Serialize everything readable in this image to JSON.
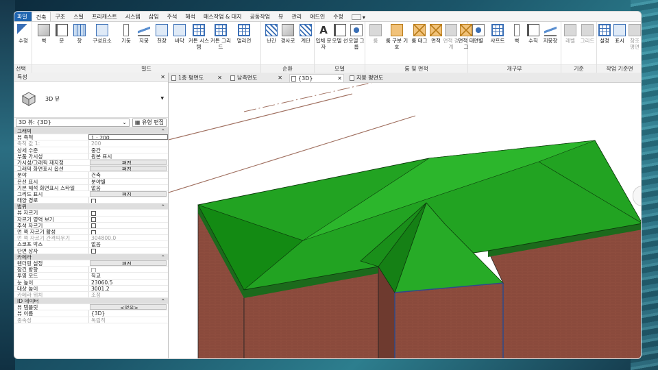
{
  "menu_tabs": [
    "파일",
    "건축",
    "구조",
    "스틸",
    "프리캐스트",
    "시스템",
    "삽입",
    "주석",
    "해석",
    "매스작업 & 대지",
    "공동작업",
    "뷰",
    "관리",
    "애드인",
    "수정"
  ],
  "active_tab": "건축",
  "ribbon": {
    "select_group": {
      "modify_label": "수정",
      "group_label": "선택"
    },
    "build_group": {
      "buttons": [
        "벽",
        "문",
        "창",
        "구성요소",
        "기둥",
        "지붕",
        "천장",
        "바닥",
        "커튼 시스템",
        "커튼 그리드",
        "멀리언"
      ],
      "group_label": "빌드"
    },
    "circulation_group": {
      "buttons": [
        "난간",
        "경사로",
        "계단"
      ],
      "group_label": "순환"
    },
    "model_group": {
      "buttons": [
        "입체 문자",
        "모델 선",
        "모델 그룹"
      ],
      "group_label": "모델"
    },
    "room_group": {
      "buttons": [
        "룸",
        "룸 구분 기호",
        "룸 태그",
        "면적",
        "면적 경계",
        "면적 태그"
      ],
      "group_label": "룸 및 면적"
    },
    "opening_group": {
      "buttons": [
        "면별",
        "샤프트",
        "벽",
        "수직",
        "지붕창"
      ],
      "group_label": "개구부"
    },
    "datum_group": {
      "buttons": [
        "레벨",
        "그리드"
      ],
      "group_label": "기준"
    },
    "workplane_group": {
      "buttons": [
        "설정",
        "표시",
        "참조 평면"
      ],
      "group_label": "작업 기준면"
    }
  },
  "properties": {
    "title": "특성",
    "type_name": "3D 뷰",
    "selector": "3D 뷰: {3D}",
    "edit_type": "유형 편집",
    "sections": [
      {
        "name": "그래픽",
        "rows": [
          {
            "k": "뷰 축척",
            "v": "1 : 200",
            "style": "box"
          },
          {
            "k": "축척 값    1:",
            "v": "200",
            "style": "grey"
          },
          {
            "k": "상세 수준",
            "v": "중간"
          },
          {
            "k": "부품 가시성",
            "v": "원본 표시"
          },
          {
            "k": "가시성/그래픽 재지정",
            "v": "편집...",
            "style": "btn"
          },
          {
            "k": "그래픽 화면표시 옵션",
            "v": "편집...",
            "style": "btn"
          },
          {
            "k": "분야",
            "v": "건축"
          },
          {
            "k": "은선 표시",
            "v": "분야별"
          },
          {
            "k": "기본 해석 화면표시 스타일",
            "v": "없음"
          },
          {
            "k": "그리드 표시",
            "v": "편집...",
            "style": "btn"
          },
          {
            "k": "태양 경로",
            "v": "",
            "style": "cb"
          }
        ]
      },
      {
        "name": "범위",
        "rows": [
          {
            "k": "뷰 자르기",
            "v": "",
            "style": "cb"
          },
          {
            "k": "자르기 영역 보기",
            "v": "",
            "style": "cb"
          },
          {
            "k": "주석 자르기",
            "v": "",
            "style": "cb"
          },
          {
            "k": "먼 쪽 자르기 활성",
            "v": "",
            "style": "cb"
          },
          {
            "k": "먼 쪽 자르기 간격띄우기",
            "v": "304800.0",
            "style": "grey"
          },
          {
            "k": "스코프 박스",
            "v": "없음"
          },
          {
            "k": "단면 상자",
            "v": "",
            "style": "cb"
          }
        ]
      },
      {
        "name": "카메라",
        "rows": [
          {
            "k": "렌더링 설정",
            "v": "편집...",
            "style": "btn"
          },
          {
            "k": "잠긴 방향",
            "v": "",
            "style": "cbgrey"
          },
          {
            "k": "투영 모드",
            "v": "직교"
          },
          {
            "k": "눈 높이",
            "v": "23060.5"
          },
          {
            "k": "대상 높이",
            "v": "3001.2"
          },
          {
            "k": "카메라 위치",
            "v": "조정",
            "style": "grey"
          }
        ]
      },
      {
        "name": "ID 데이터",
        "rows": [
          {
            "k": "뷰 템플릿",
            "v": "<없음>",
            "style": "btn"
          },
          {
            "k": "뷰 이름",
            "v": "{3D}"
          },
          {
            "k": "종속성",
            "v": "독립적",
            "style": "grey"
          }
        ]
      }
    ]
  },
  "view_tabs": [
    {
      "label": "1층 평면도",
      "active": false
    },
    {
      "label": "남측면도",
      "active": false
    },
    {
      "label": "{3D}",
      "active": true
    },
    {
      "label": "지붕 평면도",
      "active": false
    }
  ],
  "colors": {
    "roof": "#1a9e1a",
    "wall": "#8a4a3c",
    "accent": "#1f65b0"
  }
}
